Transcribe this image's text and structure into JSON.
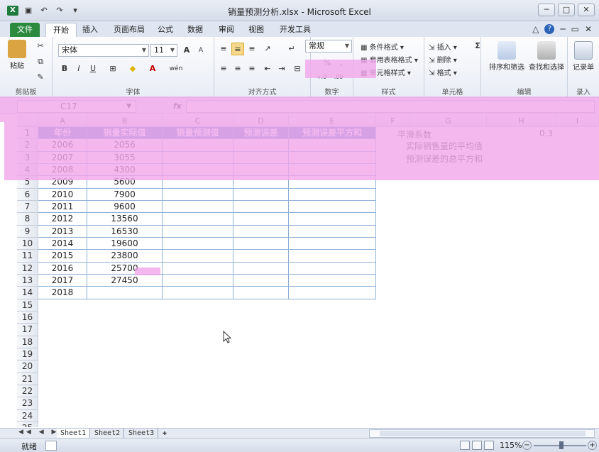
{
  "titlebar": {
    "app_icon": "X",
    "title": "销量预测分析.xlsx - Microsoft Excel",
    "qat": [
      "save-icon",
      "undo-icon",
      "redo-icon",
      "customize-icon"
    ],
    "qat_glyphs": [
      "▣",
      "↶",
      "↷",
      "▾"
    ],
    "window_buttons": [
      "─",
      "□",
      "✕"
    ]
  },
  "tabs": {
    "file": "文件",
    "items": [
      "开始",
      "插入",
      "页面布局",
      "公式",
      "数据",
      "审阅",
      "视图",
      "开发工具"
    ],
    "right_icons": [
      "△",
      "?",
      "─",
      "▭",
      "✕"
    ]
  },
  "ribbon": {
    "clipboard": {
      "paste": "粘贴",
      "cut": "✂",
      "copy": "⧉",
      "painter": "✎",
      "label": "剪贴板"
    },
    "font": {
      "name": "宋体",
      "size": "11",
      "grow": "A",
      "shrink": "A",
      "bold": "B",
      "italic": "I",
      "underline": "U",
      "border": "⊞",
      "fill": "◆",
      "color": "A",
      "wen": "wén",
      "label": "字体"
    },
    "alignment": {
      "label": "对齐方式"
    },
    "number": {
      "format": "常规",
      "percent": "%",
      "comma": ",",
      "inc": "+.0",
      "dec": ".00",
      "label": "数字"
    },
    "styles": {
      "conditional": "条件格式",
      "table": "套用表格格式",
      "cell": "单元格样式",
      "label": "样式"
    },
    "cells": {
      "insert": "插入",
      "delete": "删除",
      "format": "格式",
      "label": "单元格"
    },
    "editing": {
      "sum": "Σ",
      "sort": "排序和筛选",
      "find": "查找和选择",
      "label": "编辑"
    },
    "record": {
      "label": "记录单",
      "group_label": "录入"
    }
  },
  "formula_bar": {
    "name_box": "C17",
    "fx": "fx",
    "value": ""
  },
  "columns": [
    "A",
    "B",
    "C",
    "D",
    "E",
    "F",
    "G",
    "H",
    "I"
  ],
  "rows": [
    "1",
    "2",
    "3",
    "4",
    "5",
    "6",
    "7",
    "8",
    "9",
    "10",
    "11",
    "12",
    "13",
    "14",
    "15",
    "16",
    "17",
    "18",
    "19",
    "20",
    "21",
    "22",
    "23",
    "24",
    "25"
  ],
  "table": {
    "headers": [
      "年份",
      "销量实际值",
      "销量预测值",
      "预测误差",
      "预测误差平方和"
    ],
    "years": [
      "2006",
      "2007",
      "2008",
      "2009",
      "2010",
      "2011",
      "2012",
      "2013",
      "2014",
      "2015",
      "2016",
      "2017",
      "2018"
    ],
    "sales": [
      "2056",
      "3055",
      "4300",
      "5600",
      "7900",
      "9600",
      "13560",
      "16530",
      "19600",
      "23800",
      "25700",
      "27450",
      ""
    ]
  },
  "notes": {
    "smoothing_label": "平滑系数",
    "smoothing_value": "0.3",
    "mean_label": "实际销售量的平均值",
    "sse_label": "预测误差的总平方和"
  },
  "sheets": [
    "Sheet1",
    "Sheet2",
    "Sheet3"
  ],
  "sheet_nav": "◀◀ ◀ ▶ ▶▶",
  "status": {
    "ready": "就绪",
    "zoom": "115%",
    "minus": "−",
    "plus": "+"
  }
}
